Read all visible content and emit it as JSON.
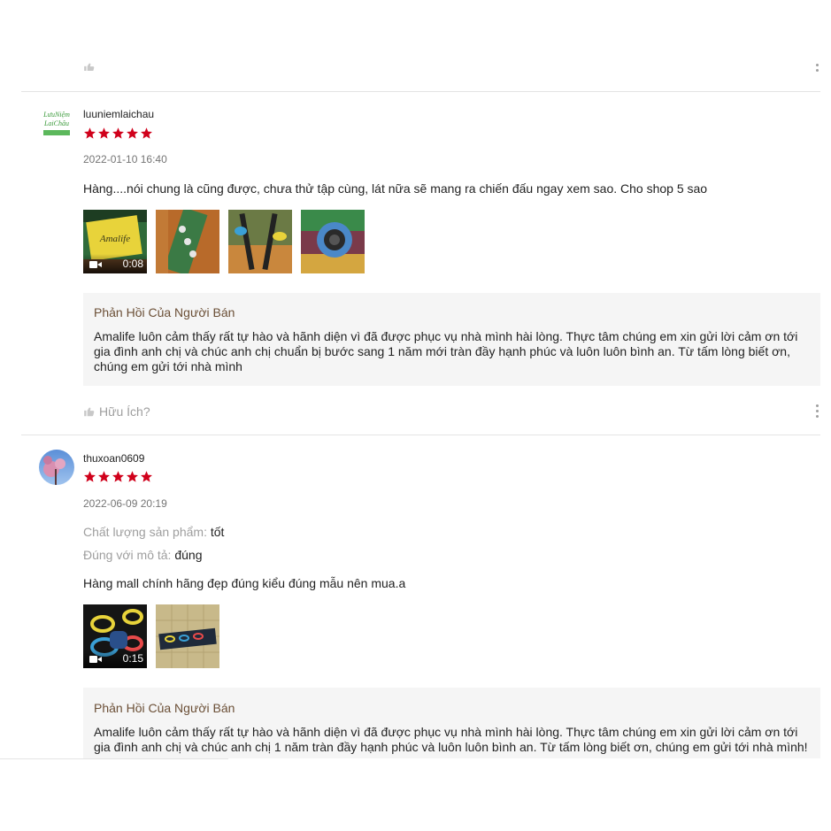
{
  "reviews": [
    {
      "username": "luuniemlaichau",
      "avatar_text": [
        "LưuNiệm",
        "LaiChâu"
      ],
      "rating": 5,
      "date": "2022-01-10 16:40",
      "comment": "Hàng....nói chung là cũng được, chưa thử tập cùng, lát nữa sẽ mang ra chiến đấu ngay xem sao. Cho shop 5 sao",
      "media": [
        {
          "type": "video",
          "duration": "0:08",
          "thumb_text": "Amalife"
        },
        {
          "type": "image"
        },
        {
          "type": "image"
        },
        {
          "type": "image"
        }
      ],
      "seller_reply": {
        "title": "Phản Hồi Của Người Bán",
        "text": "Amalife luôn cảm thấy rất tự hào và hãnh diện vì đã được phục vụ nhà mình hài lòng. Thực tâm chúng em xin gửi lời cảm ơn tới gia đình anh chị và chúc anh chị chuẩn bị bước sang 1 năm mới tràn đầy hạnh phúc và luôn luôn bình an. Từ tấm lòng biết ơn, chúng em gửi tới nhà mình"
      },
      "helpful_label": "Hữu Ích?"
    },
    {
      "username": "thuxoan0609",
      "rating": 5,
      "date": "2022-06-09 20:19",
      "attributes": [
        {
          "label": "Chất lượng sản phẩm:",
          "value": "tốt"
        },
        {
          "label": "Đúng với mô tả:",
          "value": "đúng"
        }
      ],
      "comment": "Hàng mall chính hãng đẹp đúng kiểu đúng mẫu nên mua.a",
      "media": [
        {
          "type": "video",
          "duration": "0:15"
        },
        {
          "type": "image"
        }
      ],
      "seller_reply": {
        "title": "Phản Hồi Của Người Bán",
        "text": "Amalife luôn cảm thấy rất tự hào và hãnh diện vì đã được phục vụ nhà mình hài lòng. Thực tâm chúng em xin gửi lời cảm ơn tới gia đình anh chị và chúc anh chị 1 năm tràn đầy hạnh phúc và luôn luôn bình an. Từ tấm lòng biết ơn, chúng em gửi tới nhà mình!"
      }
    }
  ],
  "colors": {
    "star": "#d0011b",
    "reply_title": "#6b4f36",
    "reply_bg": "#f5f5f5",
    "muted": "#757575"
  },
  "icons": [
    "thumbs-up-icon",
    "more-vertical-icon",
    "video-camera-icon",
    "star-icon"
  ]
}
